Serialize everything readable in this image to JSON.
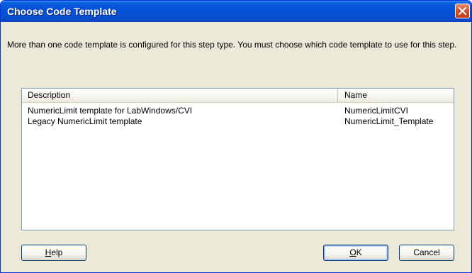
{
  "window": {
    "title": "Choose Code Template"
  },
  "message": "More than one code template is configured for this step type. You must choose which code template to use for this step.",
  "table": {
    "columns": [
      "Description",
      "Name"
    ],
    "rows": [
      {
        "description": "NumericLimit template for LabWindows/CVI",
        "name": "NumericLimitCVI"
      },
      {
        "description": "Legacy NumericLimit template",
        "name": "NumericLimit_Template"
      }
    ]
  },
  "buttons": {
    "help": {
      "mnemonic": "H",
      "rest": "elp"
    },
    "ok": {
      "mnemonic": "O",
      "rest": "K"
    },
    "cancel": "Cancel"
  },
  "colors": {
    "titlebar": "#0451d8",
    "dialog_bg": "#ece9d8",
    "close_button": "#d6532f"
  }
}
